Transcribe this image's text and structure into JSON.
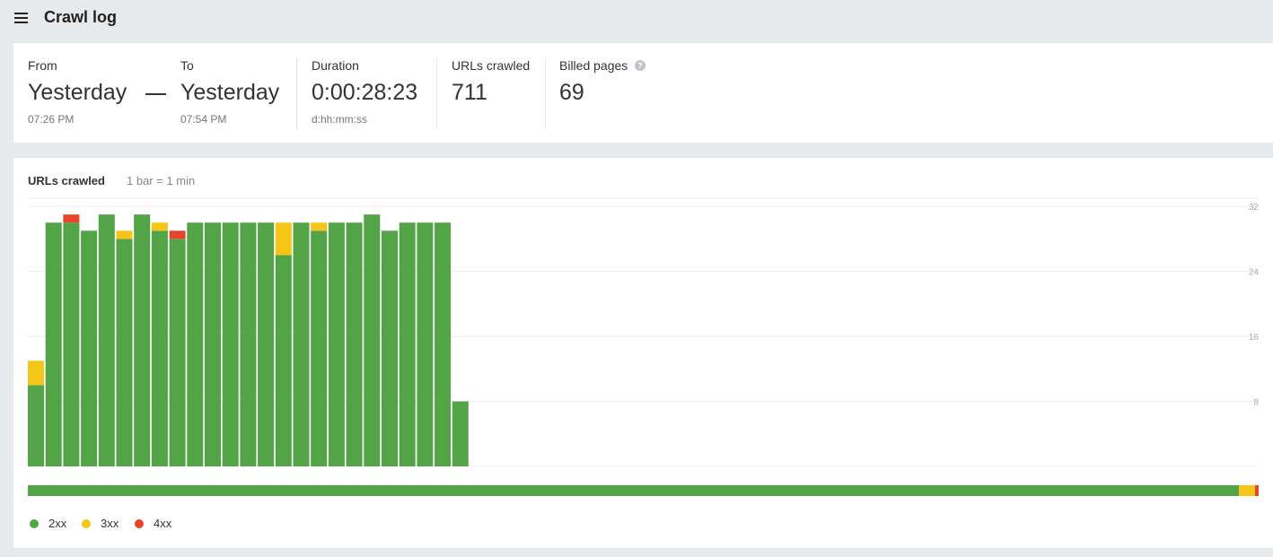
{
  "header": {
    "title": "Crawl log"
  },
  "summary": {
    "from": {
      "label": "From",
      "value": "Yesterday",
      "time": "07:26 PM"
    },
    "to": {
      "label": "To",
      "value": "Yesterday",
      "time": "07:54 PM"
    },
    "duration": {
      "label": "Duration",
      "value": "0:00:28:23",
      "format": "d:hh:mm:ss"
    },
    "urls_crawled": {
      "label": "URLs crawled",
      "value": "711"
    },
    "billed_pages": {
      "label": "Billed pages",
      "value": "69"
    }
  },
  "colors": {
    "2xx": "#52a447",
    "3xx": "#f5c518",
    "4xx": "#e8442a"
  },
  "chart_data": {
    "type": "bar",
    "title": "URLs crawled",
    "subtitle": "1 bar = 1 min",
    "stacked": true,
    "ylim": [
      0,
      32
    ],
    "yticks": [
      8,
      16,
      24,
      32
    ],
    "grid": true,
    "series": [
      {
        "name": "2xx",
        "values": [
          10,
          30,
          30,
          29,
          31,
          28,
          31,
          29,
          28,
          30,
          30,
          30,
          30,
          30,
          26,
          30,
          29,
          30,
          30,
          31,
          29,
          30,
          30,
          30,
          8
        ]
      },
      {
        "name": "3xx",
        "values": [
          3,
          0,
          0,
          0,
          0,
          1,
          0,
          1,
          0,
          0,
          0,
          0,
          0,
          0,
          4,
          0,
          1,
          0,
          0,
          0,
          0,
          0,
          0,
          0,
          0
        ]
      },
      {
        "name": "4xx",
        "values": [
          0,
          0,
          1,
          0,
          0,
          0,
          0,
          0,
          1,
          0,
          0,
          0,
          0,
          0,
          0,
          0,
          0,
          0,
          0,
          0,
          0,
          0,
          0,
          0,
          0
        ]
      }
    ],
    "totals_bar": {
      "2xx": 0.984,
      "3xx": 0.013,
      "4xx": 0.003
    },
    "legend": [
      "2xx",
      "3xx",
      "4xx"
    ],
    "legend_position": "bottom-left"
  }
}
